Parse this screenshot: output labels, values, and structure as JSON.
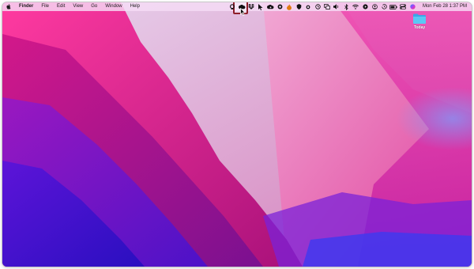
{
  "menubar": {
    "apple_icon": "apple-logo-icon",
    "app_name": "Finder",
    "items": [
      "File",
      "Edit",
      "View",
      "Go",
      "Window",
      "Help"
    ],
    "status_icons": [
      "mountain-duck-icon",
      "cloud-icon",
      "dropbox-icon",
      "arrow-icon",
      "creative-cloud-icon",
      "globe-icon",
      "flame-icon",
      "shield-icon",
      "dot-icon",
      "clock-icon",
      "screens-icon",
      "volume-icon",
      "bluetooth-icon",
      "wifi-icon",
      "play-icon",
      "user-icon",
      "time-machine-icon",
      "battery-icon",
      "control-center-icon",
      "siri-icon"
    ],
    "clock": "Mon Feb 28  1:37 PM"
  },
  "desktop": {
    "folder_label": "Today",
    "folder_color": "#5ac8f5"
  },
  "colors": {
    "highlight_box": "#8f1e2a",
    "wallpaper_primary": "#c2137a",
    "wallpaper_secondary": "#3a0fd0"
  }
}
